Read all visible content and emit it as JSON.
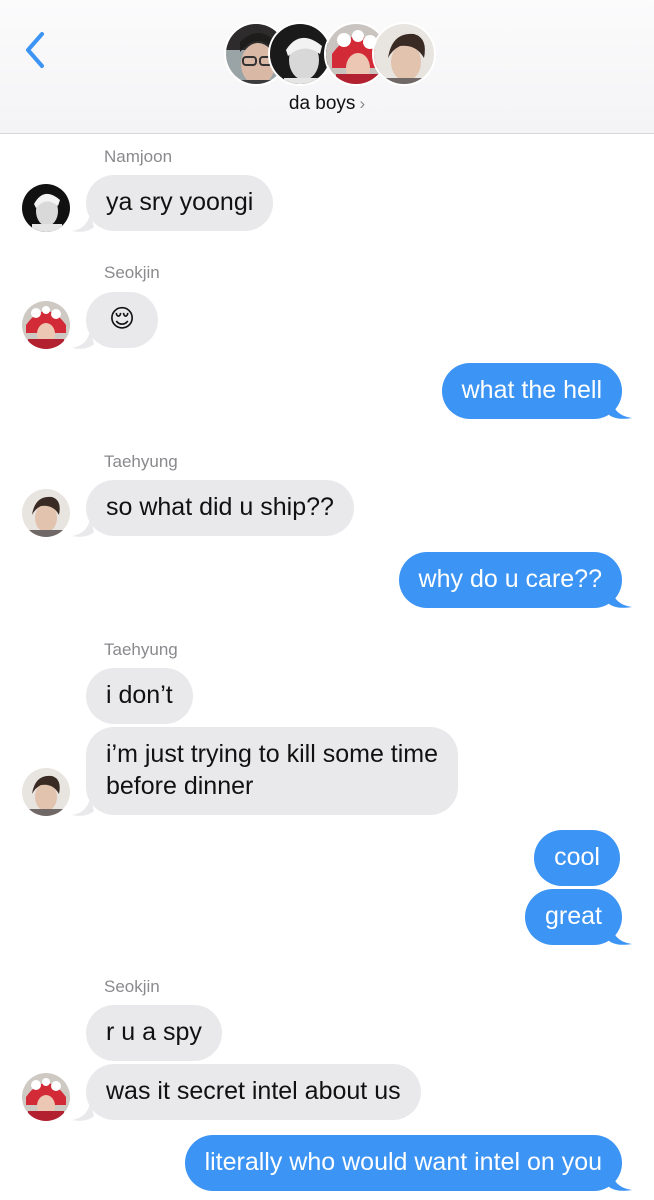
{
  "header": {
    "back_icon": "chevron-left-icon",
    "group_name": "da boys",
    "group_chevron": "›"
  },
  "colors": {
    "accent": "#3c94f4",
    "incoming_bubble": "#e9e9eb",
    "sender_label": "#8a8a8e"
  },
  "messages": [
    {
      "from": "Namjoon",
      "sender_label": "Namjoon",
      "text": "ya sry yoongi"
    },
    {
      "from": "Seokjin",
      "sender_label": "Seokjin",
      "text": "😌"
    },
    {
      "from": "me",
      "text": "what the hell"
    },
    {
      "from": "Taehyung",
      "sender_label": "Taehyung",
      "text": "so what did u ship??"
    },
    {
      "from": "me",
      "text": "why do u care??"
    },
    {
      "from": "Taehyung",
      "sender_label": "Taehyung",
      "text": "i don’t"
    },
    {
      "from": "Taehyung",
      "text_line1": "i’m just trying to kill some time",
      "text_line2": "before dinner"
    },
    {
      "from": "me",
      "text": "cool"
    },
    {
      "from": "me",
      "text": "great"
    },
    {
      "from": "Seokjin",
      "sender_label": "Seokjin",
      "text": "r u a spy"
    },
    {
      "from": "Seokjin",
      "text": "was it secret intel about us"
    },
    {
      "from": "me",
      "text": "literally who would want intel on you"
    }
  ]
}
